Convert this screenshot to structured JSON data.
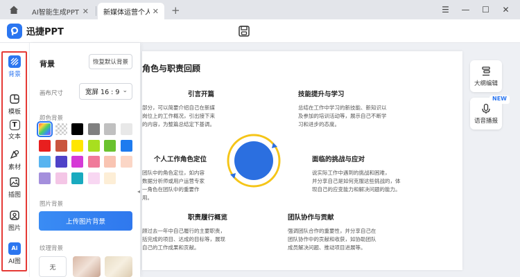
{
  "titlebar": {
    "tabs": [
      {
        "label": "AI智能生成PPT"
      },
      {
        "label": "新媒体运营个人..."
      }
    ],
    "close_glyph": "✕",
    "add_glyph": "+",
    "controls": [
      "☰",
      "—",
      "☐",
      "✕"
    ]
  },
  "app": {
    "name": "迅捷PPT",
    "brand_color": "#2b76f0"
  },
  "rail": {
    "items": [
      {
        "label": "背景",
        "icon": "background-icon"
      },
      {
        "label": "模板",
        "icon": "template-icon"
      },
      {
        "label": "文本",
        "icon": "text-icon"
      },
      {
        "label": "素材",
        "icon": "shapes-icon"
      },
      {
        "label": "插图",
        "icon": "illustration-icon"
      },
      {
        "label": "图片",
        "icon": "image-icon"
      },
      {
        "label": "AI图",
        "icon": "ai-image-icon"
      }
    ],
    "text_icon_glyph": "T",
    "ai_icon_glyph": "Ai"
  },
  "panel": {
    "title": "背景",
    "reset_label": "恢复默认背景",
    "size_label": "画布尺寸",
    "size_value": "宽屏 16 : 9",
    "size_chevron": "⌄",
    "color_label": "颜色背景",
    "colors": [
      "gradient",
      "transparent",
      "#000000",
      "#808080",
      "#c0c0c0",
      "#e8e8e8",
      "#e81f1f",
      "#c9553f",
      "#ffe600",
      "#a8df1f",
      "#6ac22f",
      "#1e7bef",
      "#58b4f0",
      "#4f42c8",
      "#d63ad6",
      "#f07a9a",
      "#f9c4b2",
      "#fbd6c6",
      "#a48fdc",
      "#f4c6e6",
      "#19aabf",
      "#f8d7f2",
      "#fdeed6"
    ],
    "image_label": "图片背景",
    "upload_label": "上传图片背景",
    "texture_label": "纹理背景",
    "texture_none": "无",
    "collapse_glyph": "◂"
  },
  "slide": {
    "title": "角色与职责回顾",
    "sections": [
      {
        "title": "引言开篇",
        "body": "部分，可以简要介绍自己在新媒\n岗位上的工作概况，引出接下来\n的内容，为整篇总结定下基调。"
      },
      {
        "title": "技能提升与学习",
        "body": "总结在工作中学习的新技能、新知识以\n及参加的培训活动等，展示自己不断学\n习和进步的态度。"
      },
      {
        "title": "个人工作角色定位",
        "body": "团队中的角色定位，如内容\n数据分析师或用户运营专家\n一角色在团队中的重要作\n用。"
      },
      {
        "title": "面临的挑战与应对",
        "body": "说实际工作中遇到的挑战和困难，\n并分享自己是如何克服这些挑战的，体\n现自己的应变能力和解决问题的能力。"
      },
      {
        "title": "职责履行概览",
        "body": "顾过去一年中自己履行的主要职责，\n括完成的项目、达成的目标等，展现\n自己的工作成果和贡献。"
      },
      {
        "title": "团队协作与贡献",
        "body": "强调团队合作的重要性，并分享自己在\n团队协作中的贡献和收获，如协助团队\n成员解决问题、推动项目进展等。"
      }
    ]
  },
  "tools": [
    {
      "label": "大纲编辑",
      "icon": "outline-edit-icon"
    },
    {
      "label": "语音播报",
      "icon": "microphone-icon",
      "badge": "NEW"
    }
  ]
}
